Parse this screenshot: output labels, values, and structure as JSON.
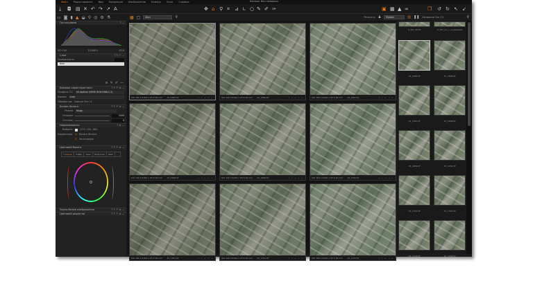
{
  "title": "Каталог без названия",
  "menu": [
    "Файл",
    "Редактировать",
    "Вид",
    "Коррекция",
    "Изображение",
    "Камера",
    "Окно",
    "Справка"
  ],
  "viewer_select": "Фон",
  "browser_bar": {
    "sort_label": "Резкость",
    "filter": "Rotate",
    "sort_by": "Название Fon 13"
  },
  "panels": {
    "histogram": {
      "title": "Гистограмма",
      "iso": "ISO 100",
      "shutter": "1/1000 s",
      "aperture": "f/5.6"
    },
    "layers": {
      "title": "Слои",
      "opacity_label": "Прозрачность",
      "layer": "Фон"
    },
    "basic": {
      "title": "Базовые характеристики",
      "icc_label": "Профиль ICC",
      "icc": "Из файла (sRGB IEC61966-2.1)",
      "curve_label": "Кривая",
      "curve": "Auto",
      "engine_label": "Обработчик",
      "engine": "Capture One 11"
    },
    "wb": {
      "title": "Баланс белого",
      "mode_label": "Режим",
      "mode": "Кадр",
      "kelvin_label": "Кельвин",
      "kelvin": "5000",
      "tint_label": "Оттенок",
      "tint": "0"
    },
    "normalize": {
      "title": "Нормализовать",
      "pick_label": "Выбрать",
      "rgb": "(179, 184, 180)",
      "adjust_label": "Корректиро.",
      "wb_check": "Баланс белого",
      "exp_check": "Экспозиция"
    },
    "color_balance": {
      "title": "Цветовой баланс",
      "tabs": [
        "Главная",
        "3-Way",
        "Тень",
        "Полутона",
        "Свет"
      ]
    },
    "bw": {
      "title": "Черно-белые изображения"
    },
    "color_editor": {
      "title": "Цветовой редактор"
    }
  },
  "caption": "ISO 100 1/1000 s f/5.6 90 mm",
  "grid": [
    "15_1695.tif",
    "15_1696.tif",
    "15_1697.tif",
    "15_1698.tif",
    "15_1699.tif",
    "15_1700.tif",
    "15_1701.tif",
    "15_1702.tif",
    "15_1703.tif"
  ],
  "browser": [
    "5_367_20.tif",
    "5_367_21_c_ссуммой.tif",
    "15_1695.tif",
    "15_1696.tif",
    "15_1697.tif",
    "15_1698.tif",
    "15_1699.tif",
    "15_1700.tif",
    "15_1701.tif",
    "15_1702.tif",
    "15_1703.tif",
    "15_1704.tif"
  ],
  "colors": {
    "accent": "#e07a20",
    "bg": "#1c1c1c"
  }
}
